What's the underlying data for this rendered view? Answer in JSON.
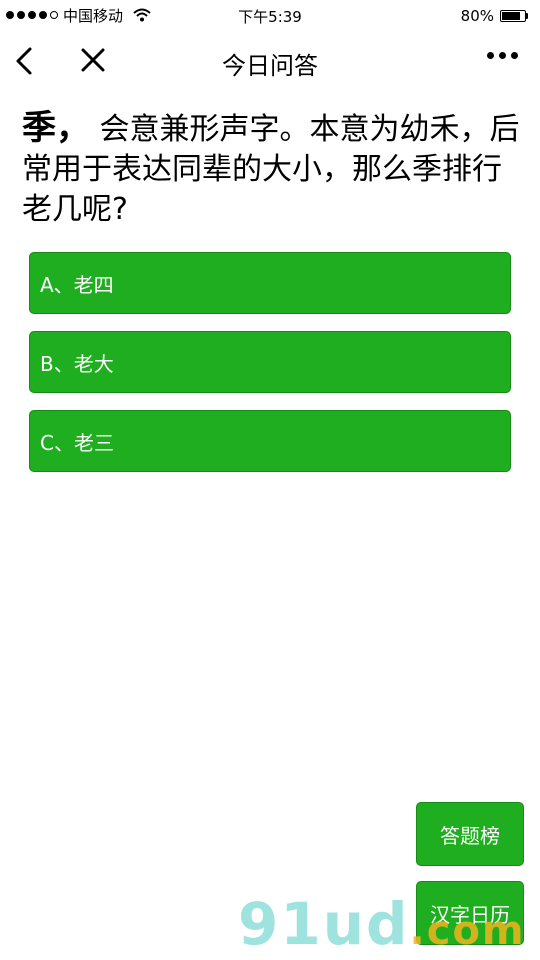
{
  "status_bar": {
    "carrier": "中国移动",
    "time": "下午5:39",
    "battery": "80%",
    "battery_level": 0.8
  },
  "nav": {
    "title": "今日问答"
  },
  "question": {
    "char": "季，",
    "text": "会意兼形声字。本意为幼禾，后常用于表达同辈的大小，那么季排行老几呢?"
  },
  "options": [
    {
      "label": "A、老四"
    },
    {
      "label": "B、老大"
    },
    {
      "label": "C、老三"
    }
  ],
  "buttons": {
    "rank": "答题榜",
    "calendar": "汉字日历"
  },
  "watermark": {
    "main": "91ud",
    "suffix": ".com"
  },
  "colors": {
    "accent": "#1fae1f"
  }
}
